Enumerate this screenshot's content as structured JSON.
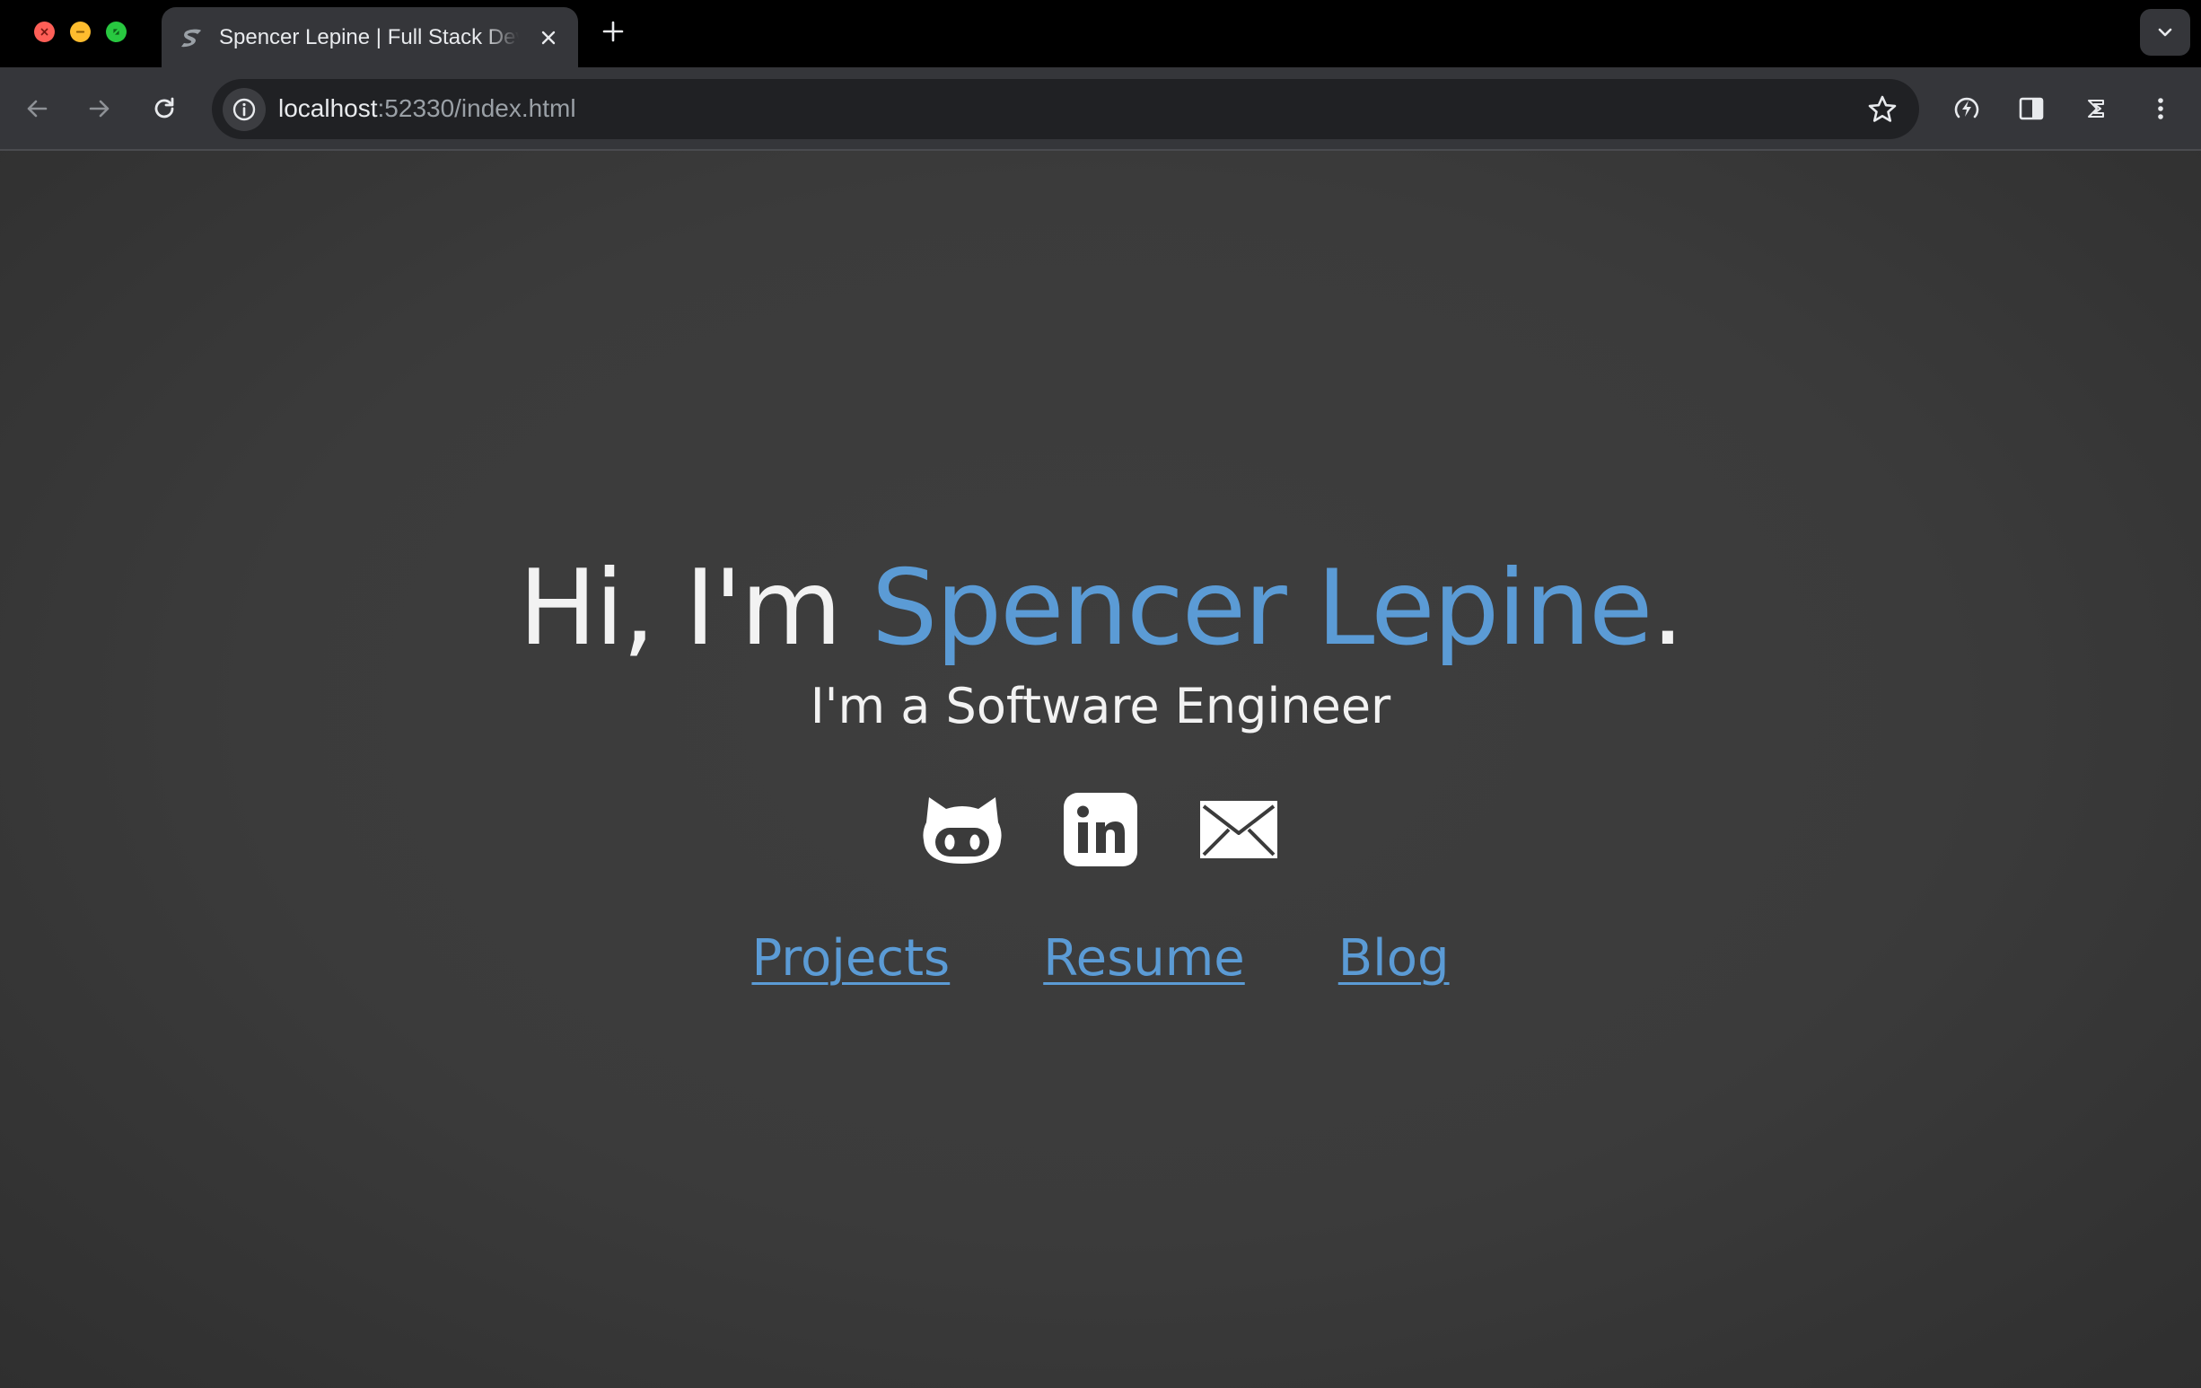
{
  "browser": {
    "tab": {
      "title": "Spencer Lepine | Full Stack Developer",
      "favicon": "spencer-logo-icon"
    },
    "address_bar": {
      "host": "localhost",
      "rest": ":52330/index.html"
    },
    "window_controls": [
      "close",
      "minimize",
      "maximize"
    ],
    "toolbar_icons": [
      "back-icon",
      "forward-icon",
      "reload-icon",
      "site-info-icon",
      "star-icon",
      "performance-icon",
      "side-panel-icon",
      "extension-icon",
      "more-menu-icon"
    ]
  },
  "page": {
    "headline": {
      "prefix": "Hi, I'm ",
      "name": "Spencer Lepine",
      "suffix": "."
    },
    "subtitle": "I'm a Software Engineer",
    "socials": [
      {
        "icon": "github-icon"
      },
      {
        "icon": "linkedin-icon"
      },
      {
        "icon": "email-icon"
      }
    ],
    "nav_links": [
      {
        "label": "Projects"
      },
      {
        "label": "Resume"
      },
      {
        "label": "Blog"
      }
    ]
  },
  "colors": {
    "accent": "#5b9bd5",
    "page_background": "#3b3b3b",
    "text": "#f2f2f2",
    "toolbar": "#35363a",
    "tabstrip": "#000000"
  }
}
